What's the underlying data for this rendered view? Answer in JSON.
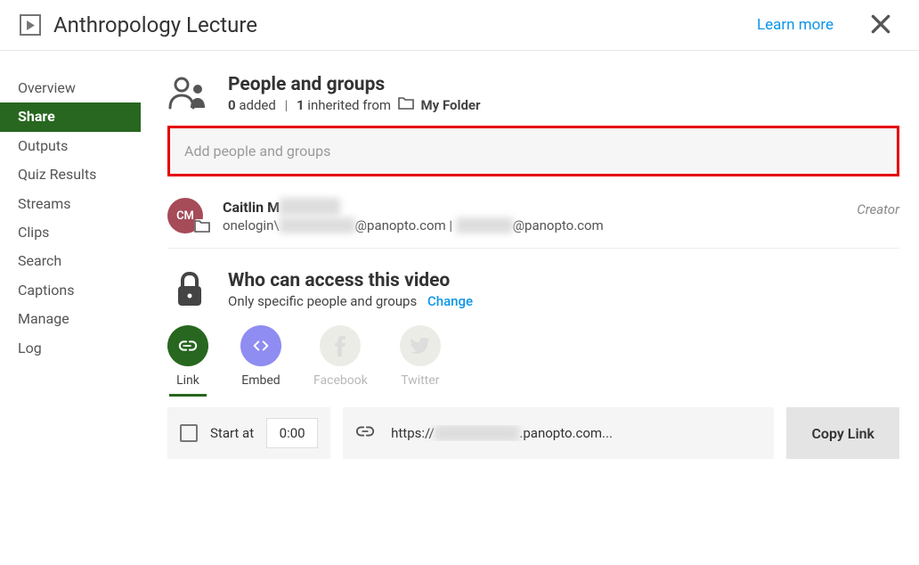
{
  "header": {
    "title": "Anthropology Lecture",
    "learn_more": "Learn more"
  },
  "sidebar": {
    "items": [
      {
        "label": "Overview"
      },
      {
        "label": "Share"
      },
      {
        "label": "Outputs"
      },
      {
        "label": "Quiz Results"
      },
      {
        "label": "Streams"
      },
      {
        "label": "Clips"
      },
      {
        "label": "Search"
      },
      {
        "label": "Captions"
      },
      {
        "label": "Manage"
      },
      {
        "label": "Log"
      }
    ],
    "active_index": 1
  },
  "people_section": {
    "title": "People and groups",
    "added_count": "0",
    "added_label": " added",
    "separator": "|",
    "inherited_count": "1",
    "inherited_label": " inherited from",
    "folder_name": "My Folder",
    "add_placeholder": "Add people and groups"
  },
  "user": {
    "initials": "CM",
    "name_prefix": "Caitlin M",
    "name_blur": "██████",
    "detail_prefix": "onelogin\\",
    "detail_blur1": "████████",
    "detail_mid": "@panopto.com | ",
    "detail_blur2": "██████",
    "detail_suffix": "@panopto.com",
    "role": "Creator"
  },
  "access_section": {
    "title": "Who can access this video",
    "subtitle": "Only specific people and groups",
    "change": "Change"
  },
  "share_tabs": [
    {
      "label": "Link"
    },
    {
      "label": "Embed"
    },
    {
      "label": "Facebook"
    },
    {
      "label": "Twitter"
    }
  ],
  "link_row": {
    "start_at": "Start at",
    "time": "0:00",
    "url_prefix": "https://",
    "url_blur": "█████████",
    "url_suffix": ".panopto.com...",
    "copy": "Copy Link"
  }
}
